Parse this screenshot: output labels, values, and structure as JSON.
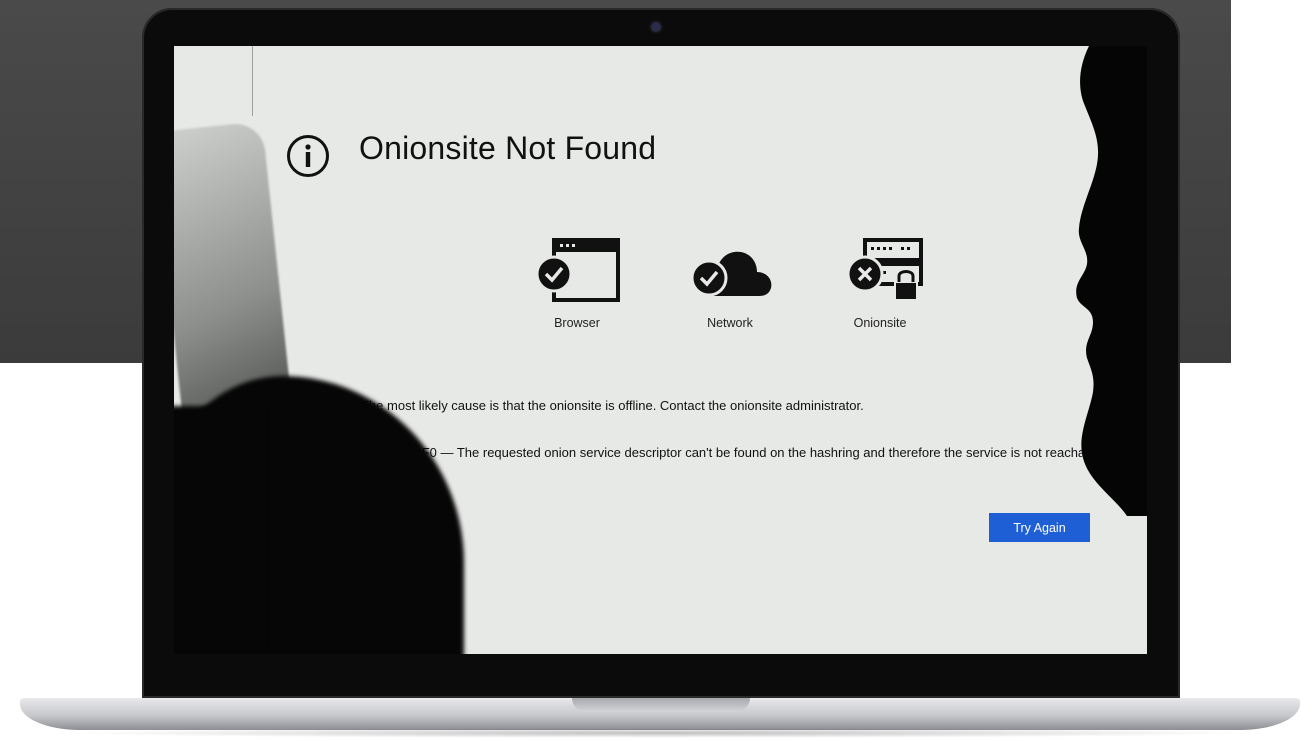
{
  "page": {
    "title": "Onionsite Not Found",
    "title_icon": "info-circle-icon"
  },
  "status_items": [
    {
      "label": "Browser",
      "icon": "browser-window-icon",
      "state": "ok"
    },
    {
      "label": "Network",
      "icon": "cloud-icon",
      "state": "ok"
    },
    {
      "label": "Onionsite",
      "icon": "server-lock-icon",
      "state": "error"
    }
  ],
  "message": {
    "cause": "The most likely cause is that the onionsite is offline. Contact the onionsite administrator.",
    "details": "Details: 0xF0 — The requested onion service descriptor can't be found on the hashring and therefore the service is not reachable by the client."
  },
  "actions": {
    "try_again_label": "Try Again"
  },
  "colors": {
    "accent": "#1f5fd6",
    "screen_background": "#e7e9e6",
    "text": "#111111"
  }
}
